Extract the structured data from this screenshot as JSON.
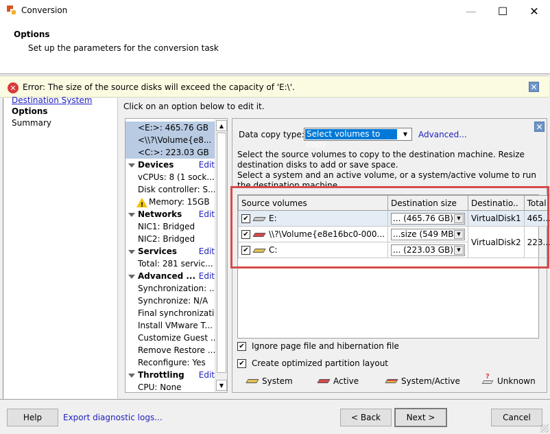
{
  "window": {
    "title": "Conversion",
    "controls": {
      "minimize": "—",
      "maximize": "☐",
      "close": "✕"
    }
  },
  "header": {
    "title": "Options",
    "subtitle": "Set up the parameters for the conversion task"
  },
  "error": {
    "icon": "✕",
    "text": "Error: The size of the source disks will exceed the capacity of 'E:\\'.",
    "close": "✕"
  },
  "nav": {
    "items": [
      {
        "label": "Destination System",
        "state": "link"
      },
      {
        "label": "Options",
        "state": "current"
      },
      {
        "label": "Summary",
        "state": "normal"
      }
    ]
  },
  "instruction": "Click on an option below to edit it.",
  "summary": {
    "volumes": [
      "<E:>: 465.76 GB",
      "<\\\\?\\Volume{e8...",
      "<C:>: 223.03 GB"
    ],
    "edit_label": "Edit",
    "sections": [
      {
        "title": "Devices",
        "items": [
          "vCPUs: 8 (1 sock...",
          "Disk controller: S...",
          "Memory: 15GB"
        ]
      },
      {
        "title": "Networks",
        "items": [
          "NIC1: Bridged",
          "NIC2: Bridged"
        ]
      },
      {
        "title": "Services",
        "items": [
          "Total: 281 servic..."
        ]
      },
      {
        "title": "Advanced ...",
        "items": [
          "Synchronization: ...",
          "Synchronize: N/A",
          "Final synchronizati...",
          "Install VMware T...",
          "Customize Guest ...",
          "Remove Restore ...",
          "Reconfigure: Yes"
        ]
      },
      {
        "title": "Throttling",
        "items": [
          "CPU: None"
        ]
      }
    ],
    "warning_item": "Memory: 15GB"
  },
  "panel": {
    "data_copy_label": "Data copy type:",
    "data_copy_value": "Select volumes to copy",
    "advanced_link": "Advanced...",
    "description_1": "Select the source volumes to copy to the destination machine. Resize destination disks to add or save space.",
    "description_2": "Select a system and an active volume, or a system/active volume to run the destination machine.",
    "table": {
      "headers": [
        "Source volumes",
        "Destination size",
        "Destinatio..",
        "Total"
      ],
      "rows": [
        {
          "checked": true,
          "type": "none",
          "volume": "E:",
          "dest_size": "... (465.76 GB)",
          "dest_disk": "VirtualDisk1",
          "total": "465...."
        },
        {
          "checked": true,
          "type": "active",
          "volume": "\\\\?\\Volume{e8e16bc0-000...",
          "dest_size": "...size (549 MB)",
          "dest_disk": "VirtualDisk2",
          "total": "223...."
        },
        {
          "checked": true,
          "type": "system",
          "volume": "C:",
          "dest_size": "... (223.03 GB)"
        }
      ]
    },
    "options": [
      {
        "label": "Ignore page file and hibernation file",
        "checked": true
      },
      {
        "label": "Create optimized partition layout",
        "checked": true
      }
    ],
    "legend": [
      "System",
      "Active",
      "System/Active",
      "Unknown"
    ],
    "check_glyph": "✔",
    "dropdown_glyph": "▼"
  },
  "footer": {
    "help": "Help",
    "export_link": "Export diagnostic logs...",
    "back": "< Back",
    "next": "Next >",
    "cancel": "Cancel"
  },
  "colors": {
    "highlight": "#d44b4b",
    "link": "#2020c0",
    "selection": "#0078d7",
    "error_bg": "#fbfbe1"
  }
}
